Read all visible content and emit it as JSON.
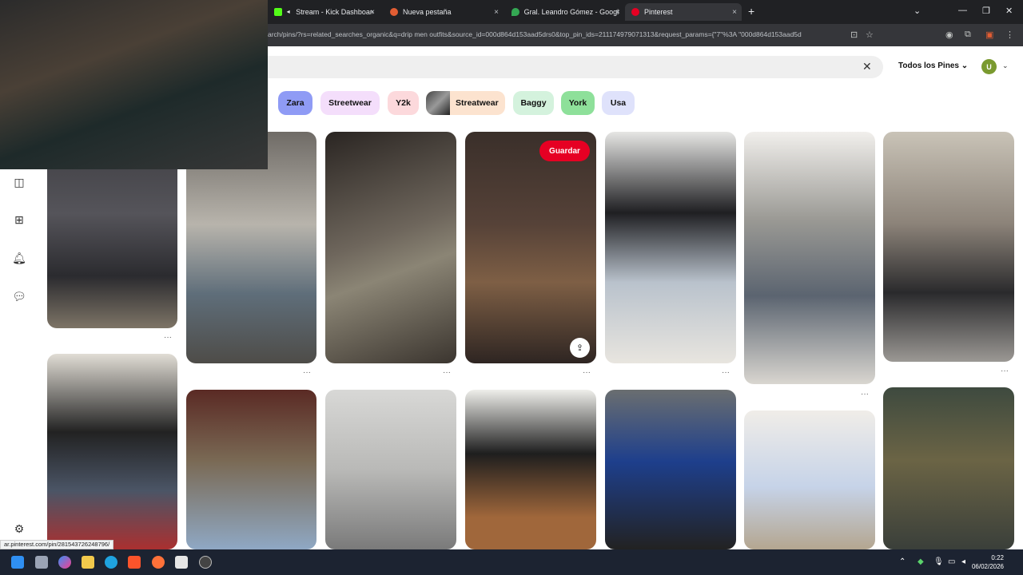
{
  "browser": {
    "tabs": [
      {
        "title": "Stream - Kick Dashboard",
        "favicon_color": "#53fc18"
      },
      {
        "title": "Nueva pestaña",
        "favicon_color": "#e25d33"
      },
      {
        "title": "Gral. Leandro Gómez - Google",
        "favicon_color": "#34a853"
      },
      {
        "title": "Pinterest",
        "favicon_color": "#e60023"
      }
    ],
    "new_tab_icon": "plus-icon",
    "url": "arch/pins/?rs=related_searches_organic&q=drip men outfits&source_id=000d864d153aad5drs0&top_pin_ids=211174979071313&request_params={\"7\"%3A \"000d864d153aad5d"
  },
  "header": {
    "filter_label": "Todos los Pines",
    "avatar_letter": "U",
    "clear_icon": "close-icon"
  },
  "chips": [
    {
      "label": "Zara",
      "color": "#8f9bf5"
    },
    {
      "label": "Streetwear",
      "color": "#f4defb"
    },
    {
      "label": "Y2k",
      "color": "#fcd9dc"
    },
    {
      "label": "Streatwear",
      "color": "#fce3cf",
      "has_thumb": true
    },
    {
      "label": "Baggy",
      "color": "#d4f2dd"
    },
    {
      "label": "York",
      "color": "#8ee09a"
    },
    {
      "label": "Usa",
      "color": "#dfe2fb"
    }
  ],
  "sidebar": {
    "icons": [
      "boards-icon",
      "create-icon",
      "notifications-icon",
      "messages-icon",
      "settings-icon"
    ]
  },
  "pins": {
    "save_label": "Guardar",
    "share_icon": "share-icon",
    "more_icon": "more-dots-icon"
  },
  "status_bar": {
    "url": "ar.pinterest.com/pin/281543726248796/"
  },
  "taskbar": {
    "time": "0:22",
    "date": "06/02/2026"
  }
}
